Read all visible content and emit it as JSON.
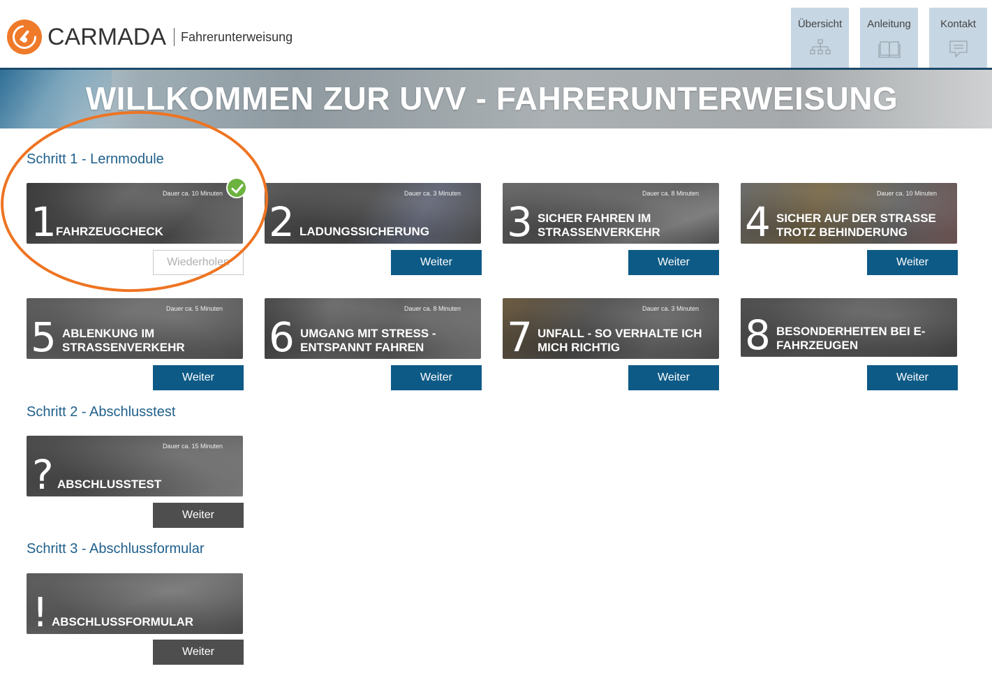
{
  "brand": {
    "name": "CARMADA",
    "subtitle": "Fahrerunterweisung",
    "accent_color": "#ee7a2a"
  },
  "nav": [
    {
      "label": "Übersicht",
      "icon": "sitemap-icon"
    },
    {
      "label": "Anleitung",
      "icon": "book-icon"
    },
    {
      "label": "Kontakt",
      "icon": "chat-icon"
    }
  ],
  "banner": {
    "title": "WILLKOMMEN ZUR UVV - FAHRERUNTERWEISUNG"
  },
  "sections": {
    "step1": "Schritt 1 - Lernmodule",
    "step2": "Schritt 2 - Abschlusstest",
    "step3": "Schritt 3 - Abschlussformular"
  },
  "modules": [
    {
      "num": "1",
      "title": "FAHRZEUGCHECK",
      "duration": "Dauer ca. 10 Minuten",
      "button": "Wiederholen",
      "completed": true
    },
    {
      "num": "2",
      "title": "LADUNGSSICHERUNG",
      "duration": "Dauer ca. 3 Minuten",
      "button": "Weiter"
    },
    {
      "num": "3",
      "title": "SICHER FAHREN IM STRASSENVERKEHR",
      "title_l1": "SICHER FAHREN IM",
      "title_l2": "STRASSENVERKEHR",
      "duration": "Dauer ca. 8 Minuten",
      "button": "Weiter"
    },
    {
      "num": "4",
      "title_l1": "SICHER AUF DER STRASSE",
      "title_l2": "TROTZ BEHINDERUNG",
      "duration": "Dauer ca. 10 Minuten",
      "button": "Weiter"
    },
    {
      "num": "5",
      "title_l1": "ABLENKUNG IM",
      "title_l2": "STRASSENVERKEHR",
      "duration": "Dauer ca. 5 Minuten",
      "button": "Weiter"
    },
    {
      "num": "6",
      "title_l1": "UMGANG MIT STRESS -",
      "title_l2": "ENTSPANNT FAHREN",
      "duration": "Dauer ca. 8 Minuten",
      "button": "Weiter"
    },
    {
      "num": "7",
      "title_l1": "UNFALL - SO VERHALTE ICH",
      "title_l2": "MICH RICHTIG",
      "duration": "Dauer ca. 3 Minuten",
      "button": "Weiter"
    },
    {
      "num": "8",
      "title_l1": "BESONDERHEITEN BEI E-",
      "title_l2": "FAHRZEUGEN",
      "button": "Weiter"
    }
  ],
  "test": {
    "num": "?",
    "title": "ABSCHLUSSTEST",
    "duration": "Dauer ca. 15 Minuten",
    "button": "Weiter"
  },
  "form": {
    "num": "!",
    "title": "ABSCHLUSSFORMULAR",
    "button": "Weiter"
  },
  "colors": {
    "nav_bg": "#c6d6e3",
    "button_blue": "#0e5a86",
    "button_grey": "#4e4e4e",
    "section_title": "#1f5f8b",
    "completed_check": "#6db33f",
    "annotation": "#ee7422"
  }
}
